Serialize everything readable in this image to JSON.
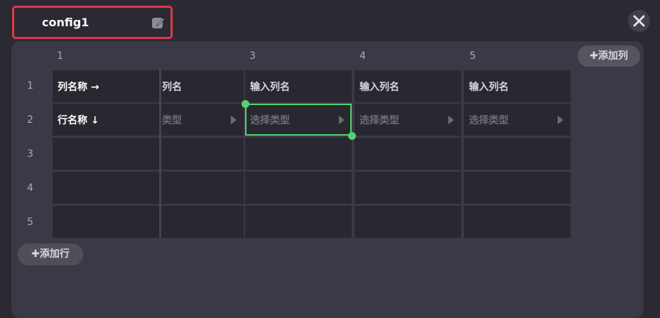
{
  "title": "config1",
  "icons": {
    "edit": "edit-icon",
    "close": "close-icon",
    "plus": "plus-icon",
    "play": "play-triangle-icon"
  },
  "colors": {
    "highlight_border": "#e0384a",
    "selection": "#52d273",
    "background": "#2b2a33",
    "cell": "#292830"
  },
  "toolbar": {
    "add_column": "添加列",
    "add_row": "添加行"
  },
  "column_headers": [
    "1",
    "3",
    "4",
    "5"
  ],
  "row_headers": [
    "1",
    "2",
    "3",
    "4",
    "5"
  ],
  "grid": {
    "col1": {
      "row1": "列名称 →",
      "row2": "行名称 ↓"
    },
    "col2": {
      "row1": "列名",
      "row2": "类型"
    },
    "col3": {
      "row1": "输入列名",
      "row2": "选择类型"
    },
    "col4": {
      "row1": "输入列名",
      "row2": "选择类型"
    },
    "col5": {
      "row1": "输入列名",
      "row2": "选择类型"
    }
  },
  "selected_cell": {
    "column": "3",
    "row": "2"
  }
}
